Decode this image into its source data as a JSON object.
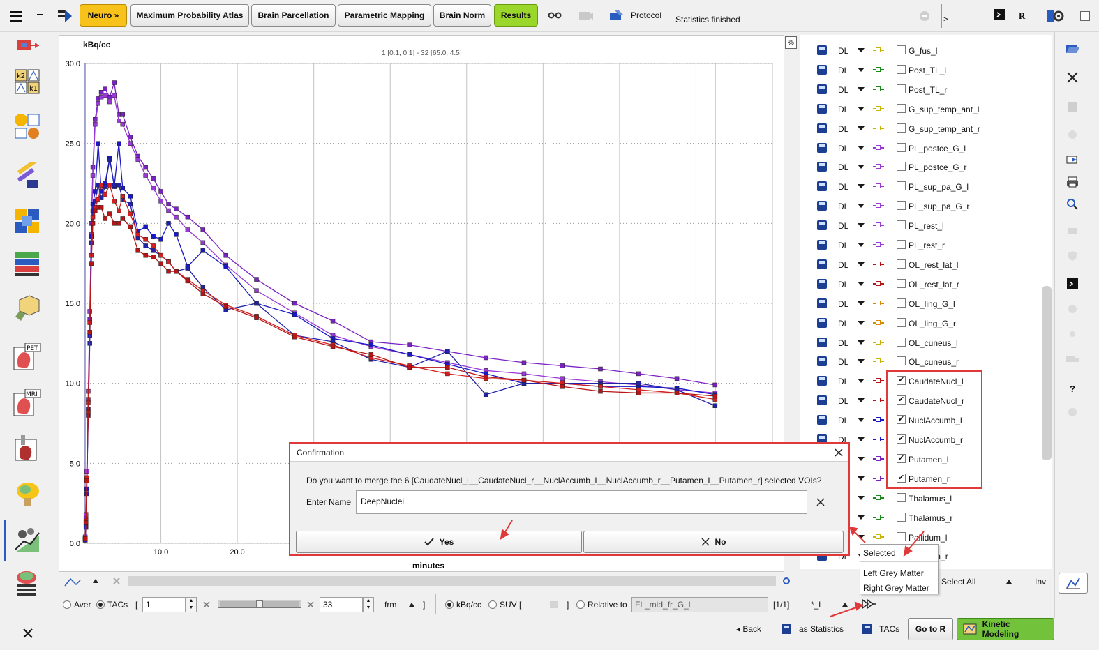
{
  "topbar": {
    "tabs": [
      "Neuro »",
      "Maximum Probability Atlas",
      "Brain Parcellation",
      "Parametric Mapping",
      "Brain Norm",
      "Results"
    ],
    "protocol_label": "Protocol",
    "status_text": "Statistics finished",
    "arrow_label": ">",
    "r_label": "R"
  },
  "chart": {
    "unit_label": "kBq/cc",
    "info_label": "1 [0.1, 0.1] - 32 [65.0, 4.5]",
    "percent_button": "%"
  },
  "chart_data": {
    "type": "line",
    "xlabel": "minutes",
    "ylabel": "kBq/cc",
    "xlim": [
      0,
      90
    ],
    "ylim": [
      0,
      30
    ],
    "xticks": [
      10.0,
      20.0
    ],
    "yticks": [
      0.0,
      5.0,
      10.0,
      15.0,
      20.0,
      25.0,
      30.0
    ],
    "grid": true,
    "x": [
      0.1,
      0.2,
      0.3,
      0.5,
      0.7,
      0.9,
      1.1,
      1.4,
      1.8,
      2.2,
      2.7,
      3.3,
      3.9,
      4.5,
      5.0,
      6.0,
      7.0,
      8.0,
      9.0,
      10.0,
      11.0,
      12.0,
      13.5,
      15.5,
      18.5,
      22.5,
      27.5,
      32.5,
      37.5,
      42.5,
      47.5,
      52.5,
      57.5,
      62.5,
      67.5,
      72.5,
      77.5,
      82.5
    ],
    "series": [
      {
        "color": "#7a22c4",
        "values": [
          0.3,
          1.5,
          4.0,
          9.0,
          14.0,
          20.0,
          23.5,
          26.5,
          27.8,
          28.2,
          28.4,
          27.9,
          28.8,
          26.8,
          26.8,
          25.4,
          24.2,
          23.5,
          22.8,
          22.0,
          21.2,
          20.9,
          20.4,
          19.6,
          18.0,
          16.5,
          15.0,
          13.9,
          12.6,
          12.4,
          12.0,
          11.6,
          11.3,
          11.1,
          10.9,
          10.6,
          10.3,
          9.9
        ]
      },
      {
        "color": "#9a3ad6",
        "values": [
          0.4,
          1.8,
          4.5,
          9.5,
          14.5,
          19.3,
          23.0,
          26.2,
          27.5,
          27.9,
          28.0,
          27.6,
          28.0,
          26.4,
          26.2,
          25.0,
          24.0,
          23.0,
          22.2,
          21.4,
          20.8,
          20.4,
          19.6,
          18.8,
          17.4,
          15.8,
          14.4,
          13.0,
          12.3,
          11.8,
          11.3,
          10.8,
          10.6,
          10.3,
          10.1,
          9.9,
          9.6,
          9.4
        ]
      },
      {
        "color": "#1818c8",
        "values": [
          0.2,
          1.2,
          3.4,
          8.4,
          13.0,
          19.2,
          21.2,
          22.0,
          25.0,
          22.0,
          22.5,
          24.1,
          22.3,
          25.0,
          22.2,
          21.7,
          19.5,
          19.8,
          19.2,
          19.0,
          20.0,
          19.3,
          17.3,
          18.3,
          17.3,
          15.0,
          14.3,
          12.8,
          12.4,
          11.8,
          11.2,
          10.6,
          10.0,
          10.0,
          9.8,
          9.8,
          9.7,
          9.3
        ]
      },
      {
        "color": "#2222a8",
        "values": [
          0.2,
          1.0,
          3.1,
          8.0,
          12.5,
          18.8,
          20.8,
          21.4,
          22.4,
          21.6,
          22.3,
          24.0,
          22.4,
          22.4,
          21.5,
          21.2,
          19.1,
          18.6,
          18.3,
          18.0,
          17.6,
          17.0,
          17.2,
          16.0,
          14.6,
          15.0,
          13.0,
          12.6,
          11.5,
          11.0,
          12.0,
          9.3,
          10.0,
          10.0,
          10.0,
          10.0,
          9.6,
          8.6
        ]
      },
      {
        "color": "#d42020",
        "values": [
          0.3,
          1.4,
          4.1,
          8.8,
          13.8,
          18.0,
          20.4,
          21.0,
          21.5,
          22.4,
          21.8,
          22.4,
          21.4,
          20.8,
          21.7,
          20.6,
          19.3,
          19.0,
          18.6,
          18.0,
          17.6,
          17.0,
          16.5,
          15.8,
          14.9,
          14.2,
          13.0,
          12.4,
          11.6,
          11.1,
          10.6,
          10.3,
          10.2,
          10.0,
          9.8,
          9.6,
          9.4,
          9.0
        ]
      },
      {
        "color": "#b81616",
        "values": [
          0.3,
          1.3,
          3.9,
          8.2,
          13.2,
          17.5,
          20.0,
          20.8,
          21.0,
          21.0,
          20.3,
          20.6,
          20.0,
          20.0,
          20.3,
          19.8,
          18.3,
          18.0,
          17.9,
          17.5,
          17.0,
          17.0,
          16.4,
          15.6,
          14.8,
          14.1,
          12.9,
          12.3,
          11.8,
          11.0,
          11.0,
          10.4,
          10.2,
          9.8,
          9.5,
          9.4,
          9.4,
          9.2
        ]
      }
    ]
  },
  "voi_list": {
    "items": [
      {
        "name": "G_fus_l",
        "dl": "DL",
        "color": "#c8b400",
        "checked": false
      },
      {
        "name": "Post_TL_l",
        "dl": "DL",
        "color": "#1a8a1a",
        "checked": false
      },
      {
        "name": "Post_TL_r",
        "dl": "DL",
        "color": "#1a8a1a",
        "checked": false
      },
      {
        "name": "G_sup_temp_ant_l",
        "dl": "DL",
        "color": "#c8b400",
        "checked": false
      },
      {
        "name": "G_sup_temp_ant_r",
        "dl": "DL",
        "color": "#c8b400",
        "checked": false
      },
      {
        "name": "PL_postce_G_l",
        "dl": "DL",
        "color": "#9a3ad6",
        "checked": false
      },
      {
        "name": "PL_postce_G_r",
        "dl": "DL",
        "color": "#9a3ad6",
        "checked": false
      },
      {
        "name": "PL_sup_pa_G_l",
        "dl": "DL",
        "color": "#9a3ad6",
        "checked": false
      },
      {
        "name": "PL_sup_pa_G_r",
        "dl": "DL",
        "color": "#9a3ad6",
        "checked": false
      },
      {
        "name": "PL_rest_l",
        "dl": "DL",
        "color": "#9a3ad6",
        "checked": false
      },
      {
        "name": "PL_rest_r",
        "dl": "DL",
        "color": "#9a3ad6",
        "checked": false
      },
      {
        "name": "OL_rest_lat_l",
        "dl": "DL",
        "color": "#b81616",
        "checked": false
      },
      {
        "name": "OL_rest_lat_r",
        "dl": "DL",
        "color": "#b81616",
        "checked": false
      },
      {
        "name": "OL_ling_G_l",
        "dl": "DL",
        "color": "#d88a00",
        "checked": false
      },
      {
        "name": "OL_ling_G_r",
        "dl": "DL",
        "color": "#d88a00",
        "checked": false
      },
      {
        "name": "OL_cuneus_l",
        "dl": "DL",
        "color": "#c8b400",
        "checked": false
      },
      {
        "name": "OL_cuneus_r",
        "dl": "DL",
        "color": "#c8b400",
        "checked": false
      },
      {
        "name": "CaudateNucl_l",
        "dl": "DL",
        "color": "#b81616",
        "checked": true
      },
      {
        "name": "CaudateNucl_r",
        "dl": "DL",
        "color": "#b81616",
        "checked": true
      },
      {
        "name": "NuclAccumb_l",
        "dl": "DL",
        "color": "#1818c8",
        "checked": true
      },
      {
        "name": "NuclAccumb_r",
        "dl": "DL",
        "color": "#1818c8",
        "checked": true
      },
      {
        "name": "Putamen_l",
        "dl": "DL",
        "color": "#7a22c4",
        "checked": true
      },
      {
        "name": "Putamen_r",
        "dl": "DL",
        "color": "#7a22c4",
        "checked": true
      },
      {
        "name": "Thalamus_l",
        "dl": "DL",
        "color": "#1a8a1a",
        "checked": false
      },
      {
        "name": "Thalamus_r",
        "dl": "DL",
        "color": "#1a8a1a",
        "checked": false
      },
      {
        "name": "Pallidum_l",
        "dl": "DL",
        "color": "#c8b400",
        "checked": false
      },
      {
        "name": "Pallidum_r",
        "dl": "DL",
        "color": "#c8b400",
        "checked": false
      }
    ],
    "select_all": "Select All",
    "inv": "Inv"
  },
  "controls": {
    "aver_label": "Aver",
    "tacs_label": "TACs",
    "bracket_open": "[",
    "from_value": "1",
    "to_value": "33",
    "frm_label": "frm",
    "bracket_close": "]",
    "kbq_label": "kBq/cc",
    "suv_label": "SUV [",
    "suv_close": "]",
    "relative_label": "Relative to",
    "relative_value": "FL_mid_fr_G_l",
    "page_count": "[1/1]",
    "filter_label": "*_l"
  },
  "footer": {
    "back": "Back",
    "as_statistics": "as Statistics",
    "tacs": "TACs",
    "go_to_r": "Go to R",
    "kinetic_modeling": "Kinetic Modeling"
  },
  "dialog": {
    "title": "Confirmation",
    "message": "Do you want to merge the 6 [CaudateNucl_l__CaudateNucl_r__NuclAccumb_l__NuclAccumb_r__Putamen_l__Putamen_r] selected VOIs?",
    "name_label": "Enter Name",
    "name_value": "DeepNuclei",
    "yes": "Yes",
    "no": "No"
  },
  "popup": {
    "items": [
      "Selected",
      "Left Grey Matter",
      "Right Grey Matter"
    ]
  },
  "colors": {
    "accent_red": "#e0393a",
    "neuro_tab": "#f7c21a",
    "results_tab": "#9bd62a",
    "kinetic_btn": "#72c23c"
  }
}
